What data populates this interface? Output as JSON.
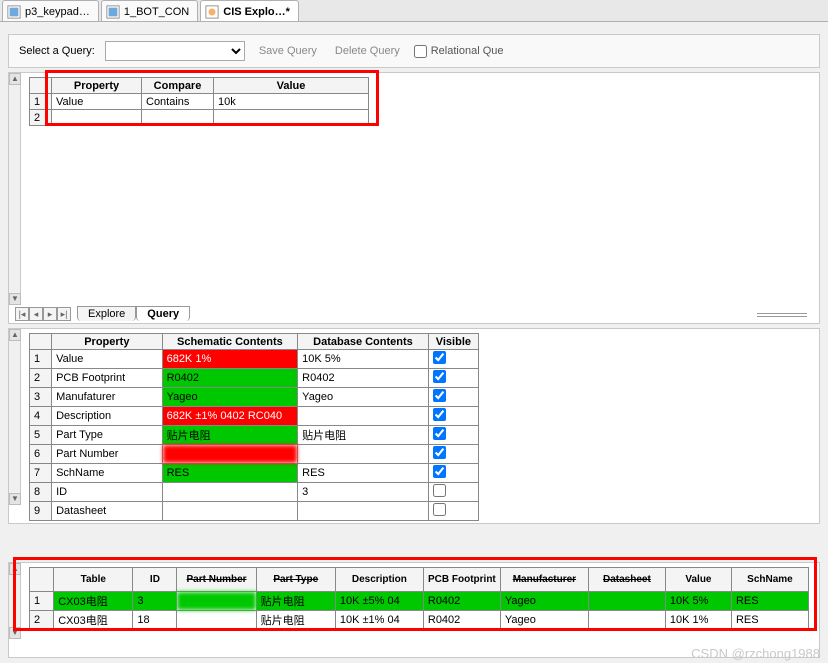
{
  "filetabs": [
    {
      "label": "p3_keypad…"
    },
    {
      "label": "1_BOT_CON"
    },
    {
      "label": "CIS Explo…*"
    }
  ],
  "toolbar": {
    "label": "Select a Query:",
    "save": "Save Query",
    "delete": "Delete Query",
    "relational": "Relational Que"
  },
  "queryGrid": {
    "headers": [
      "",
      "Property",
      "Compare",
      "Value"
    ],
    "rows": [
      {
        "n": "1",
        "property": "Value",
        "compare": "Contains",
        "value": "10k"
      },
      {
        "n": "2",
        "property": "",
        "compare": "",
        "value": ""
      }
    ]
  },
  "subtabs": {
    "explore": "Explore",
    "query": "Query"
  },
  "compareGrid": {
    "headers": [
      "",
      "Property",
      "Schematic Contents",
      "Database Contents",
      "Visible"
    ],
    "rows": [
      {
        "n": "1",
        "prop": "Value",
        "sch": "682K 1%",
        "schCls": "c-red",
        "db": "10K 5%",
        "vis": true
      },
      {
        "n": "2",
        "prop": "PCB Footprint",
        "sch": "R0402",
        "schCls": "c-green",
        "db": "R0402",
        "vis": true
      },
      {
        "n": "3",
        "prop": "Manufaturer",
        "sch": "Yageo",
        "schCls": "c-green",
        "db": "Yageo",
        "vis": true
      },
      {
        "n": "4",
        "prop": "Description",
        "sch": "682K ±1% 0402 RC040",
        "schCls": "c-red",
        "db": "",
        "dbBlur": true,
        "vis": true
      },
      {
        "n": "5",
        "prop": "Part Type",
        "sch": "贴片电阻",
        "schCls": "c-green",
        "db": "贴片电阻",
        "vis": true
      },
      {
        "n": "6",
        "prop": "Part Number",
        "sch": "",
        "schCls": "c-red",
        "schBlur": true,
        "db": "",
        "dbBlur": true,
        "vis": true
      },
      {
        "n": "7",
        "prop": "SchName",
        "sch": "RES",
        "schCls": "c-green",
        "db": "RES",
        "vis": true
      },
      {
        "n": "8",
        "prop": "ID",
        "sch": "",
        "schCls": "",
        "db": "3",
        "vis": false
      },
      {
        "n": "9",
        "prop": "Datasheet",
        "sch": "",
        "schCls": "",
        "db": "",
        "vis": false
      }
    ]
  },
  "resultsGrid": {
    "headers": [
      "",
      "Table",
      "ID",
      "Part Number",
      "Part Type",
      "Description",
      "PCB Footprint",
      "Manufacturer",
      "Datasheet",
      "Value",
      "SchName"
    ],
    "headerStrike": {
      "3": true,
      "4": true,
      "7": true,
      "8": true
    },
    "rows": [
      {
        "n": "1",
        "cls": "c-green",
        "table": "CX03电阻",
        "id": "3",
        "pn": "",
        "pnBlur": true,
        "pt": "贴片电阻",
        "desc": "10K ±5% 04",
        "fp": "R0402",
        "mfr": "Yageo",
        "ds": "",
        "val": "10K 5%",
        "sch": "RES"
      },
      {
        "n": "2",
        "cls": "",
        "table": "CX03电阻",
        "id": "18",
        "pn": "",
        "pnBlur": true,
        "pt": "贴片电阻",
        "desc": "10K ±1% 04",
        "fp": "R0402",
        "mfr": "Yageo",
        "ds": "",
        "val": "10K 1%",
        "sch": "RES"
      }
    ]
  },
  "watermark": "CSDN @rzchong1988"
}
